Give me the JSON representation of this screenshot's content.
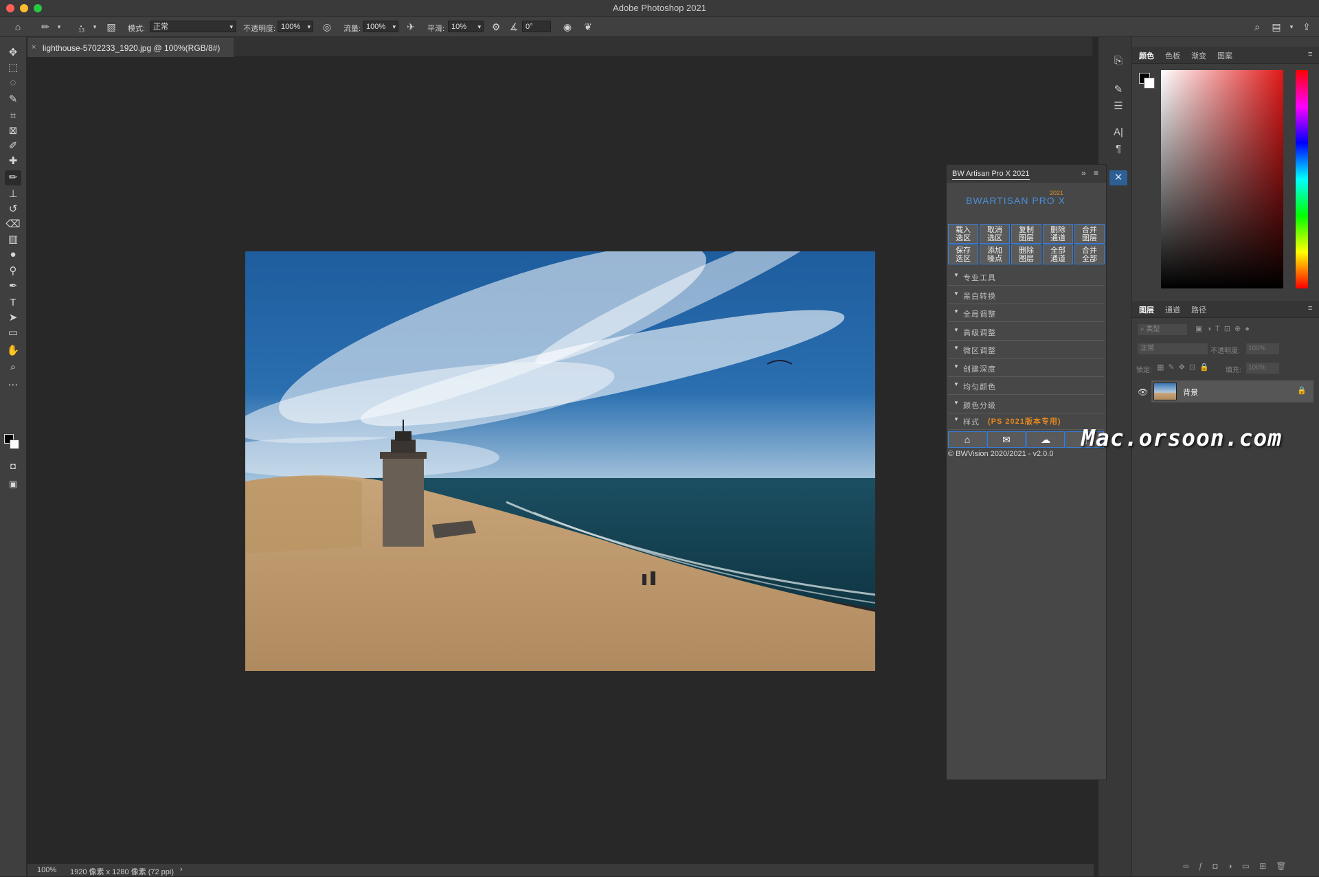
{
  "app": {
    "title": "Adobe Photoshop 2021"
  },
  "options_bar": {
    "brush_size": "13",
    "mode_label": "模式:",
    "mode_value": "正常",
    "opacity_label": "不透明度:",
    "opacity_value": "100%",
    "flow_label": "流量:",
    "flow_value": "100%",
    "smooth_label": "平滑:",
    "smooth_value": "10%",
    "angle_value": "0°"
  },
  "document": {
    "tab_name": "lighthouse-5702233_1920.jpg @ 100%(RGB/8#)",
    "close_symbol": "×"
  },
  "status_bar": {
    "zoom": "100%",
    "info": "1920 像素 x 1280 像素 (72 ppi)",
    "arrow": "›"
  },
  "tools": [
    {
      "name": "move-tool",
      "glyph": "✥"
    },
    {
      "name": "marquee-tool",
      "glyph": "⬚"
    },
    {
      "name": "lasso-tool",
      "glyph": "◌"
    },
    {
      "name": "quick-select-tool",
      "glyph": "✎"
    },
    {
      "name": "crop-tool",
      "glyph": "⌗"
    },
    {
      "name": "frame-tool",
      "glyph": "⊠"
    },
    {
      "name": "eyedropper-tool",
      "glyph": "✐"
    },
    {
      "name": "healing-tool",
      "glyph": "✚"
    },
    {
      "name": "brush-tool",
      "glyph": "✏"
    },
    {
      "name": "stamp-tool",
      "glyph": "⊥"
    },
    {
      "name": "history-brush-tool",
      "glyph": "↺"
    },
    {
      "name": "eraser-tool",
      "glyph": "⌫"
    },
    {
      "name": "gradient-tool",
      "glyph": "▥"
    },
    {
      "name": "blur-tool",
      "glyph": "●"
    },
    {
      "name": "dodge-tool",
      "glyph": "⚲"
    },
    {
      "name": "pen-tool",
      "glyph": "✒"
    },
    {
      "name": "type-tool",
      "glyph": "T"
    },
    {
      "name": "path-select-tool",
      "glyph": "➤"
    },
    {
      "name": "rectangle-tool",
      "glyph": "▭"
    },
    {
      "name": "hand-tool",
      "glyph": "✋"
    },
    {
      "name": "zoom-tool",
      "glyph": "⌕"
    },
    {
      "name": "more-tools",
      "glyph": "⋯"
    }
  ],
  "right_panels": {
    "color_tabs": [
      "颜色",
      "色板",
      "渐变",
      "图案"
    ],
    "layer_tabs": [
      "图层",
      "通道",
      "路径"
    ],
    "layer_filter_placeholder": "类型",
    "blend_mode": "正常",
    "opacity_label": "不透明度:",
    "opacity_value": "100%",
    "lock_label": "锁定:",
    "fill_label": "填充:",
    "fill_value": "100%",
    "layer_name": "背景"
  },
  "bw_panel": {
    "title": "BW Artisan Pro X 2021",
    "logo_text": "BWARTISAN PRO X",
    "logo_year": "2021",
    "buttons_row1": [
      "载入\n选区",
      "取消\n选区",
      "复制\n图层",
      "删除\n通道",
      "合并\n图层"
    ],
    "buttons_row2": [
      "保存\n选区",
      "添加\n噪点",
      "删除\n图层",
      "全部\n通道",
      "合并\n全部"
    ],
    "sections": [
      "专业工具",
      "黑白转换",
      "全局调整",
      "高级调整",
      "微区调整",
      "创建深度",
      "均匀颜色",
      "颜色分级"
    ],
    "style_label": "样式",
    "style_note": "(PS 2021版本专用)",
    "copyright": "© BWVision 2020/2021 - v2.0.0"
  },
  "watermark": "Mac.orsoon.com"
}
